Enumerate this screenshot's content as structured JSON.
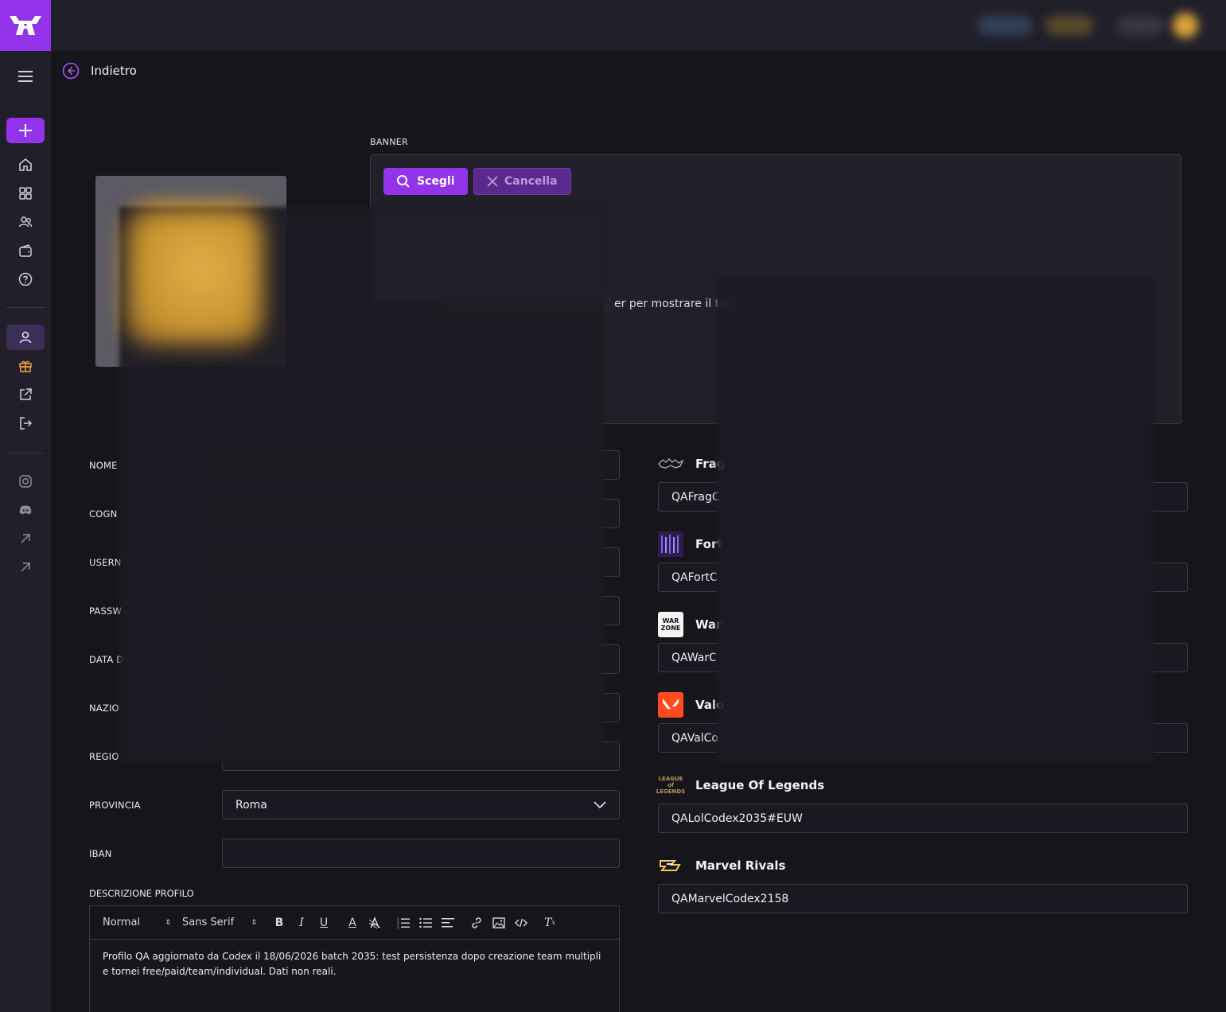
{
  "nav": {
    "back_label": "Indietro"
  },
  "banner": {
    "label": "BANNER",
    "choose_label": "Scegli",
    "clear_label": "Cancella",
    "hint_fragment": "er per mostrare il tuo"
  },
  "form": {
    "nome_label": "NOME",
    "cognome_label": "COGN",
    "username_label": "USERN",
    "password_label": "PASSW",
    "data_label": "DATA D",
    "nazione_label": "NAZIO",
    "regione_label": "REGIO",
    "provincia_label": "PROVINCIA",
    "provincia_value": "Roma",
    "iban_label": "IBAN",
    "iban_value": ""
  },
  "games": [
    {
      "name": "Frag",
      "value": "QAFragC"
    },
    {
      "name": "Fort",
      "value": "QAFortC"
    },
    {
      "name": "War",
      "value": "QAWarC"
    },
    {
      "name": "Valo",
      "value": "QAValCo"
    },
    {
      "name": "League Of Legends",
      "value": "QALolCodex2035#EUW"
    },
    {
      "name": "Marvel Rivals",
      "value": "QAMarvelCodex2158"
    }
  ],
  "game_logos": {
    "warzone_text": "WAR ZONE",
    "lol_text": "LEAGUE of LEGENDS"
  },
  "editor": {
    "label": "DESCRIZIONE PROFILO",
    "format_select": "Normal",
    "font_select": "Sans Serif",
    "content": "Profilo QA aggiornato da Codex il 18/06/2026 batch 2035: test persistenza dopo creazione team multipli e tornei free/paid/team/individual. Dati non reali."
  },
  "colors": {
    "accent": "#9333ea",
    "accent_dark": "#5b2a8f",
    "background": "#17151c",
    "panel": "#211f2a"
  }
}
